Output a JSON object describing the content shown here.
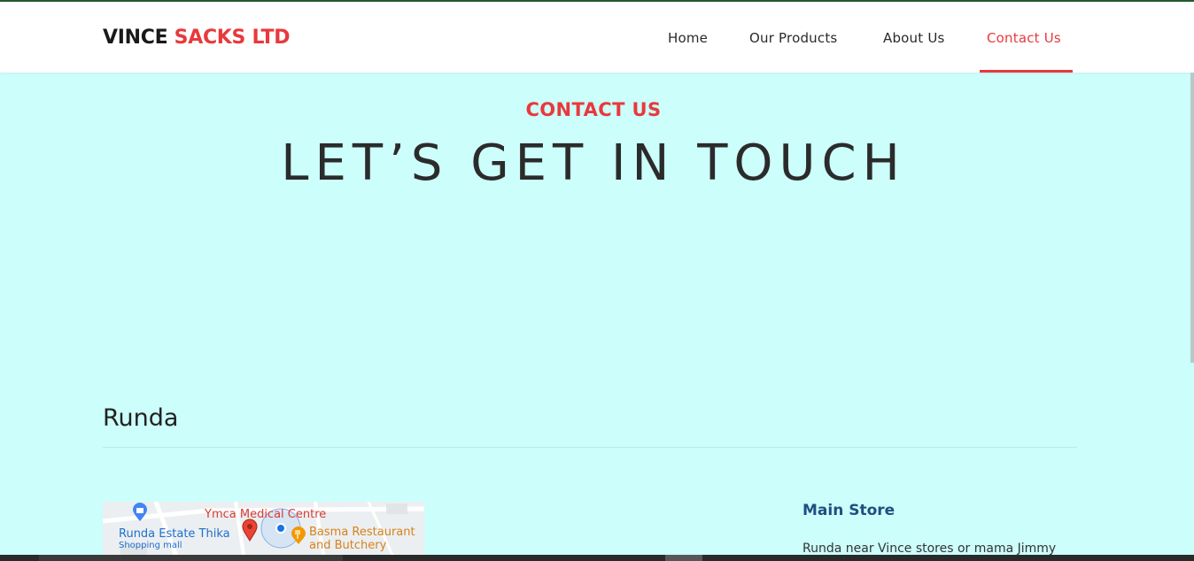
{
  "header": {
    "brand_part1": "VINCE",
    "brand_part2": "SACKS LTD",
    "nav": [
      {
        "label": "Home",
        "active": false
      },
      {
        "label": "Our Products",
        "active": false
      },
      {
        "label": "About Us",
        "active": false
      },
      {
        "label": "Contact Us",
        "active": true
      }
    ]
  },
  "hero": {
    "eyebrow": "CONTACT US",
    "title": "LET’S GET IN TOUCH"
  },
  "location": {
    "title": "Runda",
    "map": {
      "label_ymca": "Ymca Medical Centre",
      "label_runda": "Runda Estate Thika",
      "label_shop": "Shopping mall",
      "label_basma_1": "Basma Restaurant",
      "label_basma_2": "and Butchery"
    },
    "store": {
      "title": "Main Store",
      "address": "Runda near Vince stores or mama Jimmy"
    }
  },
  "colors": {
    "accent": "#e8393c",
    "background": "#ccfefb",
    "heading": "#2b2b2b",
    "store_title": "#1e4f80"
  }
}
